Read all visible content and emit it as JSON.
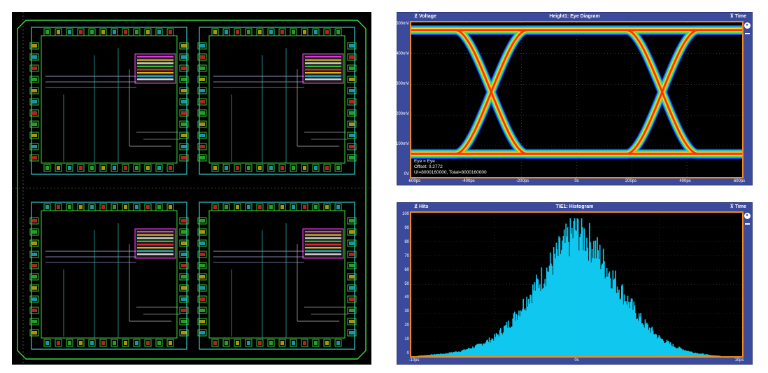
{
  "eye": {
    "y_axis_label": "Voltage",
    "title": "Height1: Eye Diagram",
    "x_axis_label": "Time",
    "y_ticks": [
      "500mV",
      "400mV",
      "300mV",
      "200mV",
      "100mV",
      "0V"
    ],
    "x_ticks": [
      "-600ps",
      "-400ps",
      "-200ps",
      "0s",
      "200ps",
      "400ps",
      "600ps"
    ],
    "readout": {
      "line1": "Eye = Eye",
      "line2": "Offset: 0.2772",
      "line3": "UI=8000160000, Total=8000160000"
    },
    "colors": {
      "frame": "#f08a1a",
      "bar": "#3b4a9b"
    }
  },
  "hist": {
    "y_axis_label": "Hits",
    "title": "TIE1: Histogram",
    "x_axis_label": "Time",
    "y_ticks": [
      "100",
      "90",
      "80",
      "70",
      "60",
      "50",
      "40",
      "30",
      "20",
      "10",
      "0"
    ],
    "x_ticks": [
      "-10ps",
      "0s",
      "10ps"
    ],
    "colors": {
      "fill": "#10c8ef",
      "frame": "#f08a1a"
    }
  },
  "layout_panel": {
    "icons": [
      "chip-layout-quadrant",
      "pad-ring-icon"
    ]
  },
  "icons": {
    "plus_icon": "+",
    "minus_icon": "−",
    "eye_control_icon": "●"
  },
  "chart_data": [
    {
      "type": "line",
      "title": "Height1: Eye Diagram",
      "xlabel": "Time",
      "ylabel": "Voltage",
      "x_unit": "ps",
      "y_unit": "mV",
      "xlim": [
        -600,
        600
      ],
      "ylim": [
        -50,
        550
      ],
      "series": [
        {
          "x": [
            -600,
            -450,
            -300,
            300,
            450,
            600
          ],
          "y": [
            520,
            520,
            280,
            280,
            520,
            520
          ]
        },
        {
          "x": [
            -600,
            -450,
            -300,
            300,
            450,
            600
          ],
          "y": [
            40,
            40,
            280,
            280,
            40,
            40
          ]
        }
      ],
      "eye_crossings": [
        -310,
        310
      ]
    },
    {
      "type": "bar",
      "title": "TIE1: Histogram",
      "xlabel": "Time",
      "ylabel": "Hits",
      "xlim": [
        -10,
        10
      ],
      "ylim": [
        0,
        100
      ],
      "x_unit": "ps",
      "bins": [
        -10,
        -9,
        -8,
        -7,
        -6,
        -5,
        -4,
        -3,
        -2,
        -1,
        0,
        1,
        2,
        3,
        4,
        5,
        6,
        7,
        8,
        9,
        10
      ],
      "values": [
        0,
        1,
        2,
        4,
        8,
        14,
        26,
        44,
        62,
        80,
        98,
        84,
        64,
        44,
        26,
        14,
        7,
        3,
        1,
        0,
        0
      ]
    }
  ]
}
